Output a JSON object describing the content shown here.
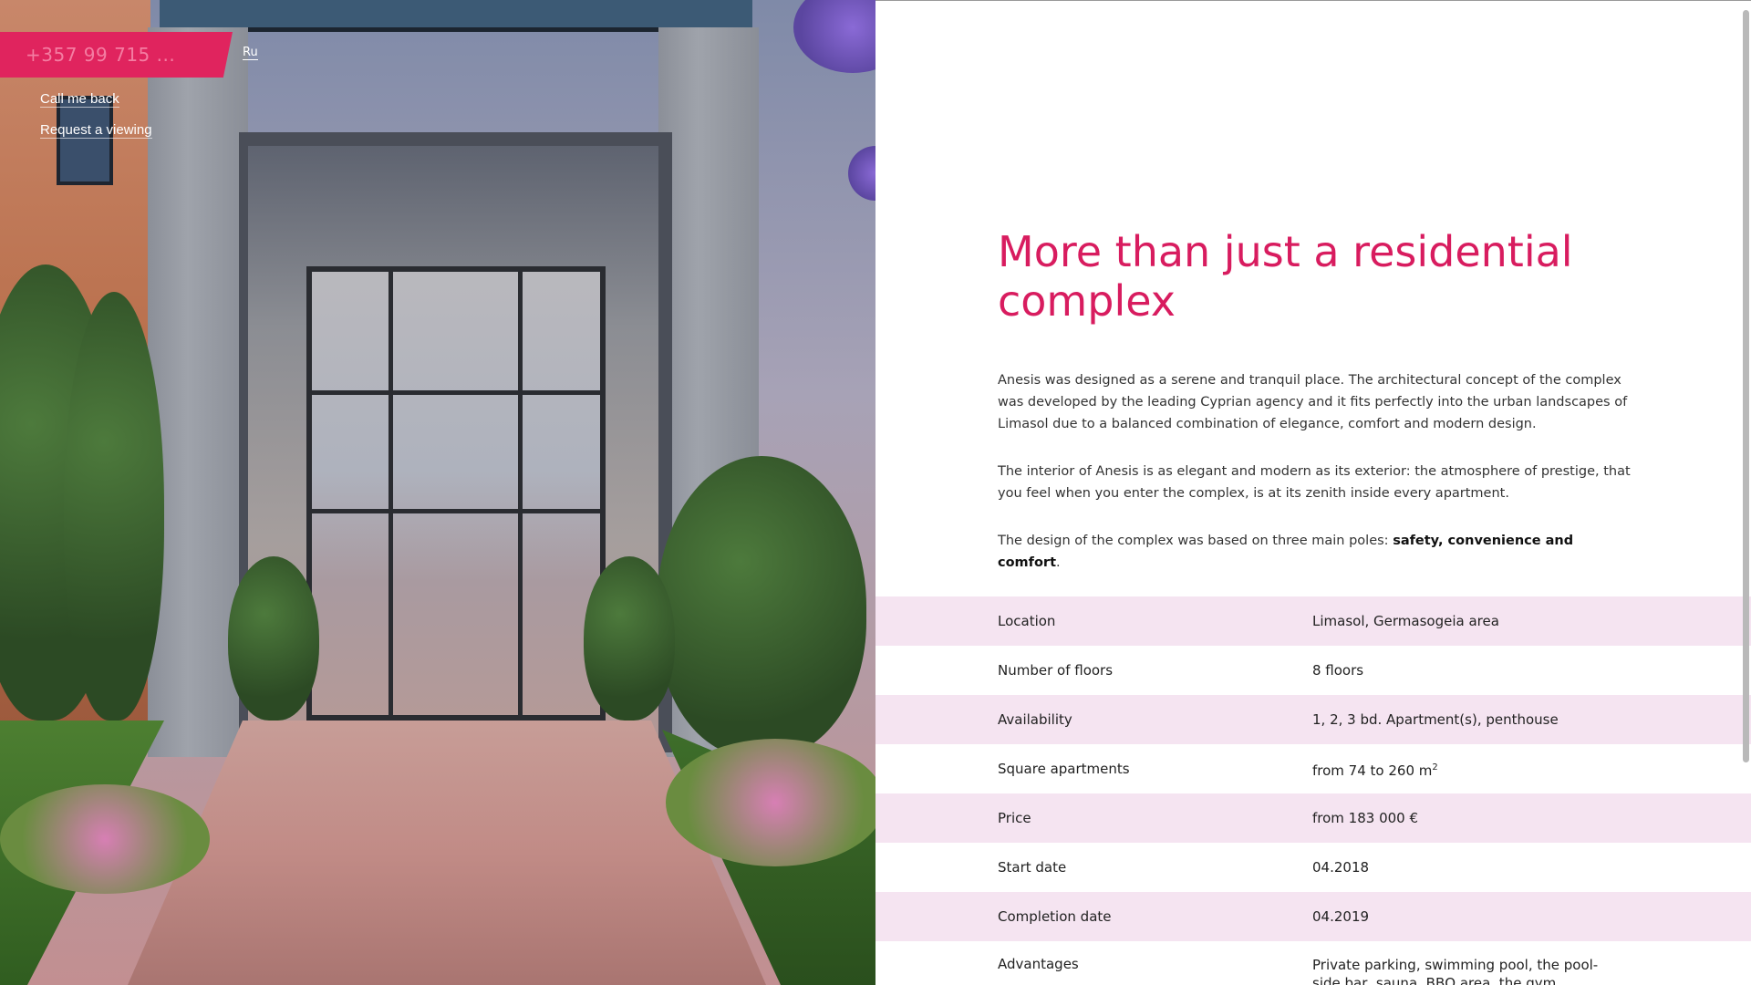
{
  "header": {
    "phone": "+357 99 715 ...",
    "lang_switch": "Ru",
    "nav": {
      "call_back": "Call me back",
      "request_viewing": "Request a viewing"
    }
  },
  "hero_image": {
    "alt": ""
  },
  "main": {
    "heading": "More than just a residential complex",
    "paragraph1": "Anesis was designed as a serene and tranquil place. The architectural concept of the complex was developed by the leading Cyprian agency and it fits perfectly into the urban landscapes of Limasol due to a balanced combination of elegance, comfort and modern design.",
    "paragraph2": "The interior of Anesis is as elegant and modern as its exterior: the atmosphere of prestige, that you feel when you enter the complex, is at its zenith inside every apartment.",
    "paragraph3_prefix": "The design of the complex was based on three main poles: ",
    "paragraph3_bold": "safety, convenience and comfort",
    "paragraph3_suffix": "."
  },
  "specs": [
    {
      "label": "Location",
      "value": "Limasol, Germasogeia area"
    },
    {
      "label": "Number of floors",
      "value": "8 floors"
    },
    {
      "label": "Availability",
      "value": "1, 2, 3 bd. Apartment(s), penthouse"
    },
    {
      "label": "Square apartments",
      "value": "from 74 to 260 m",
      "sup": "2"
    },
    {
      "label": "Price",
      "value": "from 183 000 €"
    },
    {
      "label": "Start date",
      "value": "04.2018"
    },
    {
      "label": "Completion date",
      "value": "04.2019"
    },
    {
      "label": "Advantages",
      "value": "Private parking, swimming pool, the pool-side bar, sauna, BBQ area, the gym"
    }
  ],
  "colors": {
    "accent": "#d81c5f",
    "row_stripe": "#f5e4f1"
  }
}
